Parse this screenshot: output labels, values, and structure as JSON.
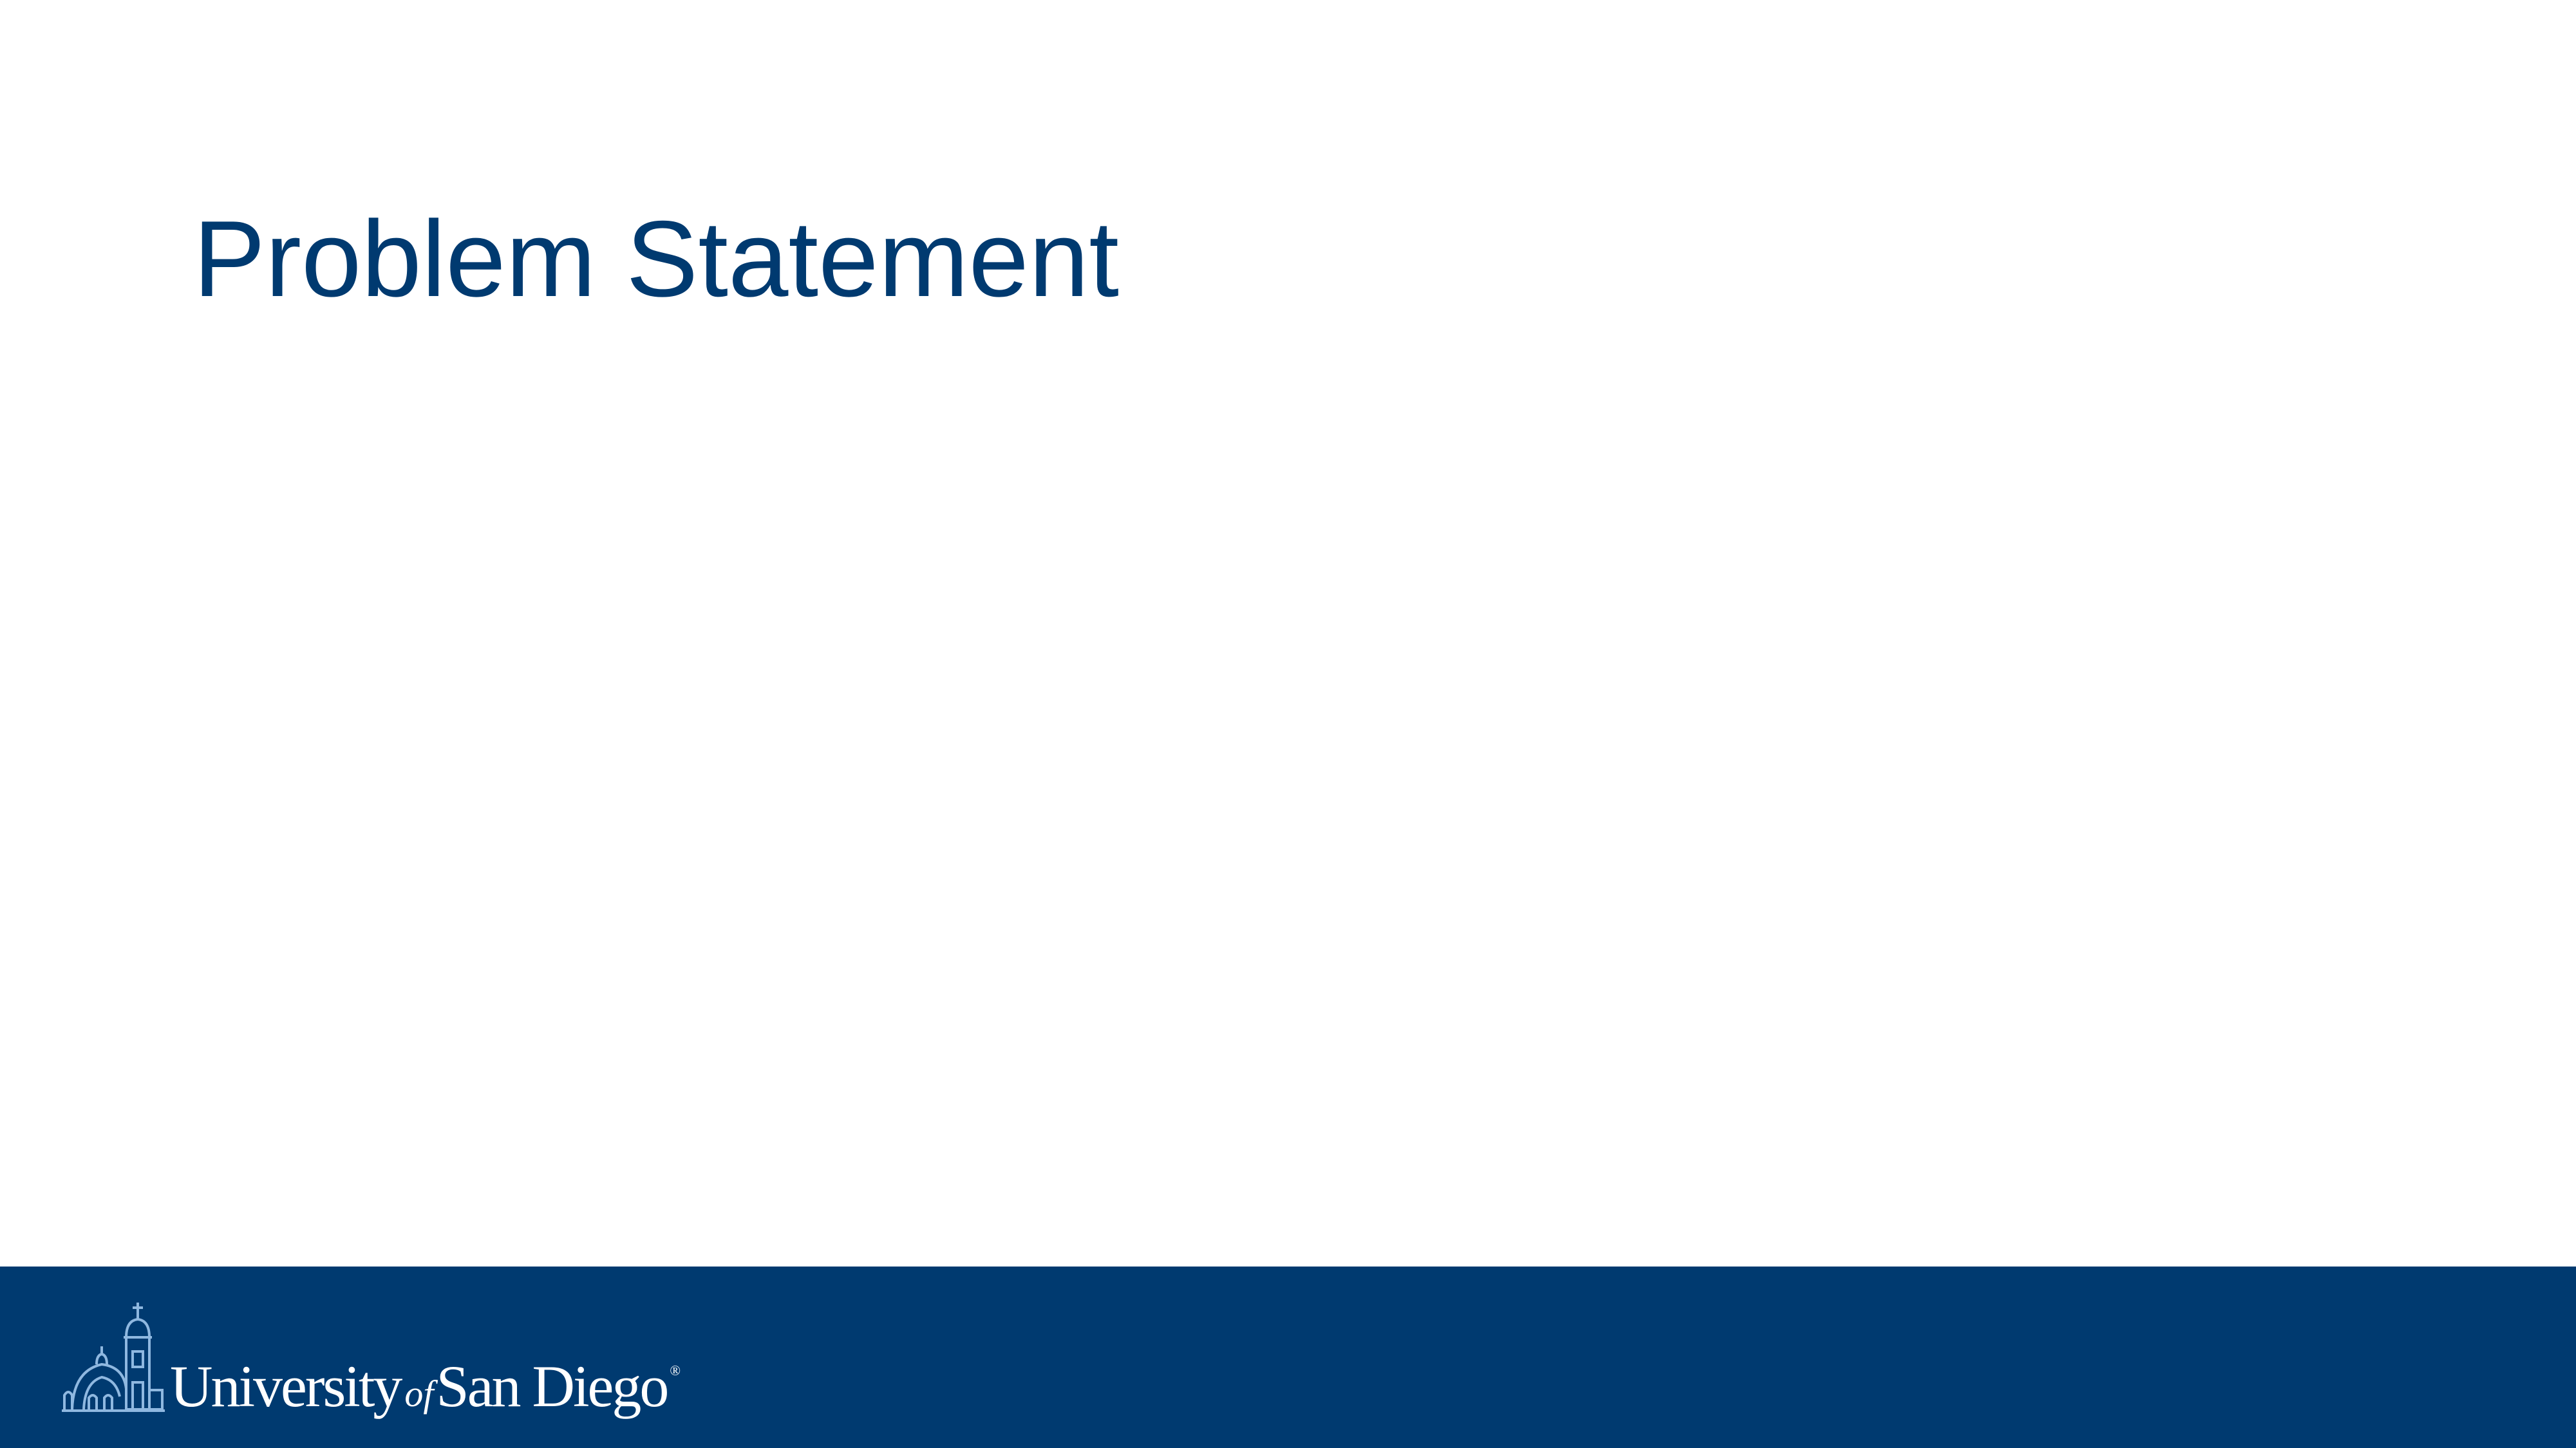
{
  "slide": {
    "title": "Problem Statement"
  },
  "footer": {
    "logo": {
      "name_part1": "University",
      "name_of": "of",
      "name_part2": "San Diego",
      "registered_mark": "®"
    }
  },
  "colors": {
    "title": "#003a70",
    "footer_background": "#003a70",
    "logo_mark": "#8fb8e0",
    "logo_text": "#ffffff"
  }
}
